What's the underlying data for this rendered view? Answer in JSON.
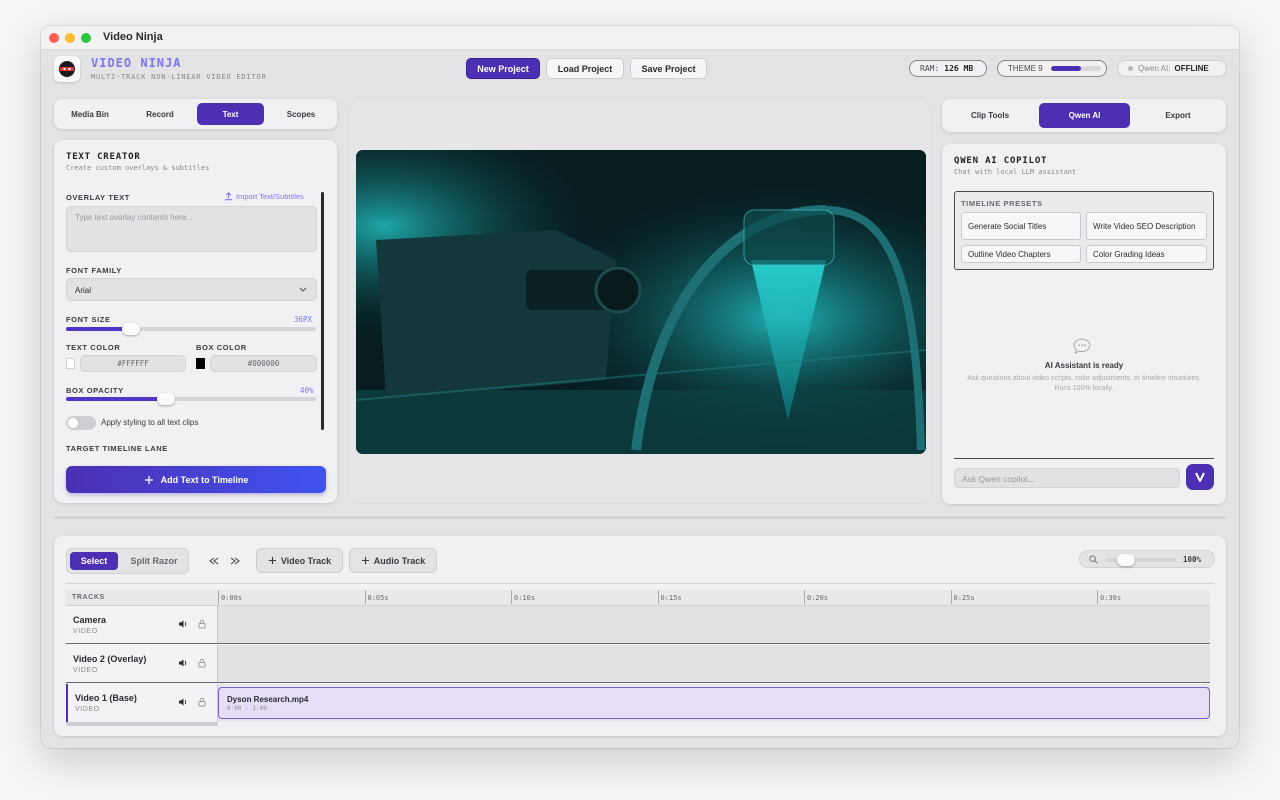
{
  "window": {
    "title": "Video Ninja"
  },
  "brand": {
    "name": "VIDEO NINJA",
    "subtitle": "MULTI-TRACK NON-LINEAR VIDEO EDITOR"
  },
  "header": {
    "new_project": "New Project",
    "load_project": "Load Project",
    "save_project": "Save Project",
    "ram_label": "RAM:",
    "ram_value": "126 MB",
    "theme_label": "THEME 9",
    "theme_level": 0.6,
    "ai_label": "Qwen AI:",
    "ai_status": "OFFLINE"
  },
  "left_tabs": [
    "Media Bin",
    "Record",
    "Text",
    "Scopes"
  ],
  "text_creator": {
    "title": "TEXT CREATOR",
    "subtitle": "Create custom overlays & subtitles",
    "overlay_label": "OVERLAY TEXT",
    "import_label": "Import Text/Subtitles",
    "overlay_placeholder": "Type text overlay contents here...",
    "font_family_label": "FONT FAMILY",
    "font_family_value": "Arial",
    "font_size_label": "FONT SIZE",
    "font_size_value": "36PX",
    "font_size_level": 0.26,
    "text_color_label": "TEXT COLOR",
    "text_color_value": "#FFFFFF",
    "box_color_label": "BOX COLOR",
    "box_color_value": "#000000",
    "box_opacity_label": "BOX OPACITY",
    "box_opacity_value": "40%",
    "box_opacity_level": 0.4,
    "apply_all_label": "Apply styling to all text clips",
    "target_lane_label": "TARGET TIMELINE LANE",
    "add_button": "Add Text to Timeline"
  },
  "right_tabs": [
    "Clip Tools",
    "Qwen AI",
    "Export"
  ],
  "copilot": {
    "title": "QWEN AI COPILOT",
    "subtitle": "Chat with local LLM assistant",
    "presets_label": "TIMELINE PRESETS",
    "presets": [
      "Generate Social Titles",
      "Write Video SEO Description",
      "Outline Video Chapters",
      "Color Grading Ideas"
    ],
    "ready_title": "AI Assistant is ready",
    "ready_text": "Ask questions about video scripts, color adjustments, or timeline structures. Runs 100% locally.",
    "input_placeholder": "Ask Qwen copilot..."
  },
  "timeline": {
    "modes": [
      "Select",
      "Split Razor"
    ],
    "add_video": "Video Track",
    "add_audio": "Audio Track",
    "zoom": "100%",
    "zoom_level": 0.28,
    "tracks_label": "TRACKS",
    "ticks": [
      "0:00s",
      "0:05s",
      "0:10s",
      "0:15s",
      "0:20s",
      "0:25s",
      "0:30s"
    ],
    "tracks": [
      {
        "name": "Camera",
        "type": "VIDEO"
      },
      {
        "name": "Video 2 (Overlay)",
        "type": "VIDEO"
      },
      {
        "name": "Video 1 (Base)",
        "type": "VIDEO"
      }
    ],
    "clip": {
      "name": "Dyson Research.mp4",
      "range": "0:00 - 1:49"
    }
  }
}
